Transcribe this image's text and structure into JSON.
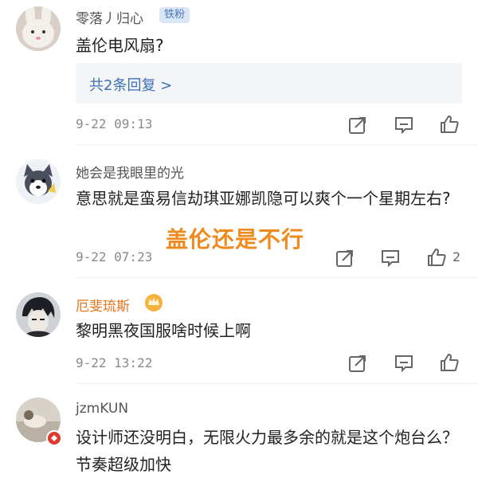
{
  "comments": [
    {
      "user": "零落丿归心",
      "badge": "铁粉",
      "text": "盖伦电风扇?",
      "replies": "共2条回复 >",
      "time": "9-22 09:13",
      "likes": ""
    },
    {
      "user": "她会是我眼里的光",
      "text": "意思就是蛮易信劫琪亚娜凯隐可以爽个一个星期左右?",
      "time": "9-22 07:23",
      "likes": "2"
    },
    {
      "user": "厄斐琉斯",
      "text": "黎明黑夜国服啥时候上啊",
      "time": "9-22 13:22",
      "likes": ""
    },
    {
      "user": "jzmKUN",
      "text": "设计师还没明白，无限火力最多余的就是这个炮台么？节奏超级加快"
    }
  ],
  "overlay_text": "盖伦还是不行",
  "colors": {
    "accent_orange": "#e8741a",
    "link_blue": "#3b6fb6"
  }
}
